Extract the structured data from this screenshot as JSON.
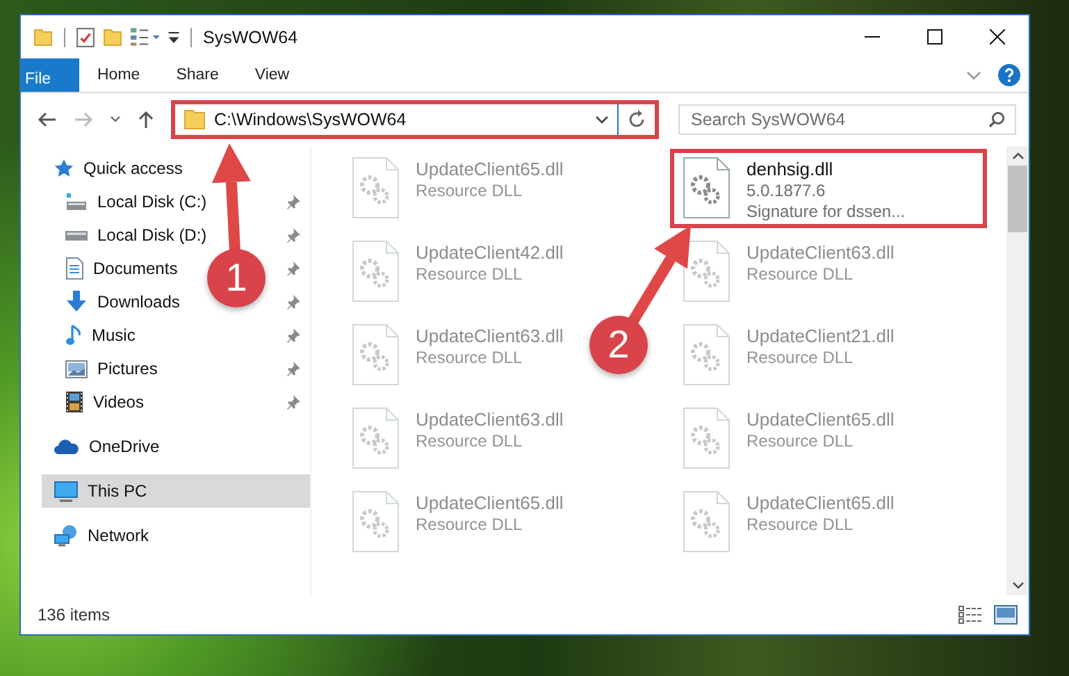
{
  "window": {
    "title": "SysWOW64"
  },
  "ribbon_tabs": [
    {
      "label": "File",
      "kind": "file"
    },
    {
      "label": "Home",
      "kind": "tab"
    },
    {
      "label": "Share",
      "kind": "tab"
    },
    {
      "label": "View",
      "kind": "tab"
    }
  ],
  "address": {
    "path": "C:\\Windows\\SysWOW64",
    "highlighted": true
  },
  "search": {
    "placeholder": "Search SysWOW64"
  },
  "sidebar": {
    "items": [
      {
        "label": "Quick access",
        "selected": false,
        "children": [
          {
            "label": "Local Disk (C:)",
            "pinned": true,
            "selected": false
          },
          {
            "label": "Local Disk (D:)",
            "pinned": true,
            "selected": false
          },
          {
            "label": "Documents",
            "pinned": true,
            "selected": false
          },
          {
            "label": "Downloads",
            "pinned": true,
            "selected": false
          },
          {
            "label": "Music",
            "pinned": true,
            "selected": false
          },
          {
            "label": "Pictures",
            "pinned": true,
            "selected": false
          },
          {
            "label": "Videos",
            "pinned": true,
            "selected": false
          }
        ]
      },
      {
        "label": "OneDrive",
        "selected": false
      },
      {
        "label": "This PC",
        "selected": true
      },
      {
        "label": "Network",
        "selected": false
      }
    ]
  },
  "files": [
    {
      "name": "UpdateClient65.dll",
      "lines": [
        "Resource DLL"
      ],
      "faded": true,
      "highlighted": false
    },
    {
      "name": "denhsig.dll",
      "lines": [
        "5.0.1877.6",
        "Signature for dssen..."
      ],
      "faded": false,
      "highlighted": true
    },
    {
      "name": "UpdateClient42.dll",
      "lines": [
        "Resource DLL"
      ],
      "faded": true,
      "highlighted": false
    },
    {
      "name": "UpdateClient63.dll",
      "lines": [
        "Resource DLL"
      ],
      "faded": true,
      "highlighted": false
    },
    {
      "name": "UpdateClient63.dll",
      "lines": [
        "Resource DLL"
      ],
      "faded": true,
      "highlighted": false
    },
    {
      "name": "UpdateClient21.dll",
      "lines": [
        "Resource DLL"
      ],
      "faded": true,
      "highlighted": false
    },
    {
      "name": "UpdateClient63.dll",
      "lines": [
        "Resource DLL"
      ],
      "faded": true,
      "highlighted": false
    },
    {
      "name": "UpdateClient65.dll",
      "lines": [
        "Resource DLL"
      ],
      "faded": true,
      "highlighted": false
    },
    {
      "name": "UpdateClient65.dll",
      "lines": [
        "Resource DLL"
      ],
      "faded": true,
      "highlighted": false
    },
    {
      "name": "UpdateClient65.dll",
      "lines": [
        "Resource DLL"
      ],
      "faded": true,
      "highlighted": false
    }
  ],
  "status_bar": {
    "item_count": "136 items"
  },
  "annotations": [
    {
      "number": "1"
    },
    {
      "number": "2"
    }
  ]
}
